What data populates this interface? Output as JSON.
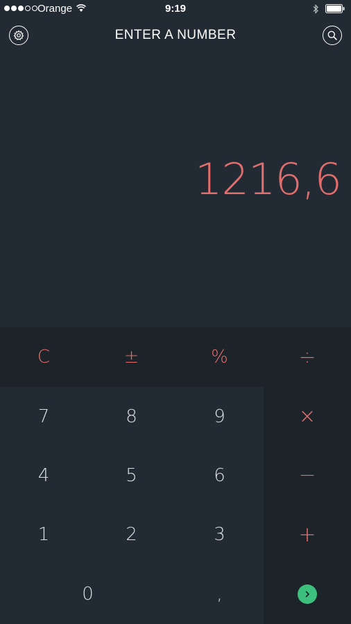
{
  "status": {
    "carrier": "Orange",
    "time": "9:19"
  },
  "header": {
    "title": "ENTER A NUMBER",
    "settings_icon": "gear-icon",
    "search_icon": "search-icon"
  },
  "display": {
    "value": "1216,6"
  },
  "keys": {
    "function": [
      "C",
      "±",
      "%"
    ],
    "operators": [
      "÷",
      "×",
      "−",
      "+"
    ],
    "digits": [
      "7",
      "8",
      "9",
      "4",
      "5",
      "6",
      "1",
      "2",
      "3"
    ],
    "zero": "0",
    "decimal": ","
  },
  "colors": {
    "background": "#222b33",
    "panel": "#1c2329",
    "accent": "#e26d6d",
    "enter": "#3dbf7d"
  }
}
